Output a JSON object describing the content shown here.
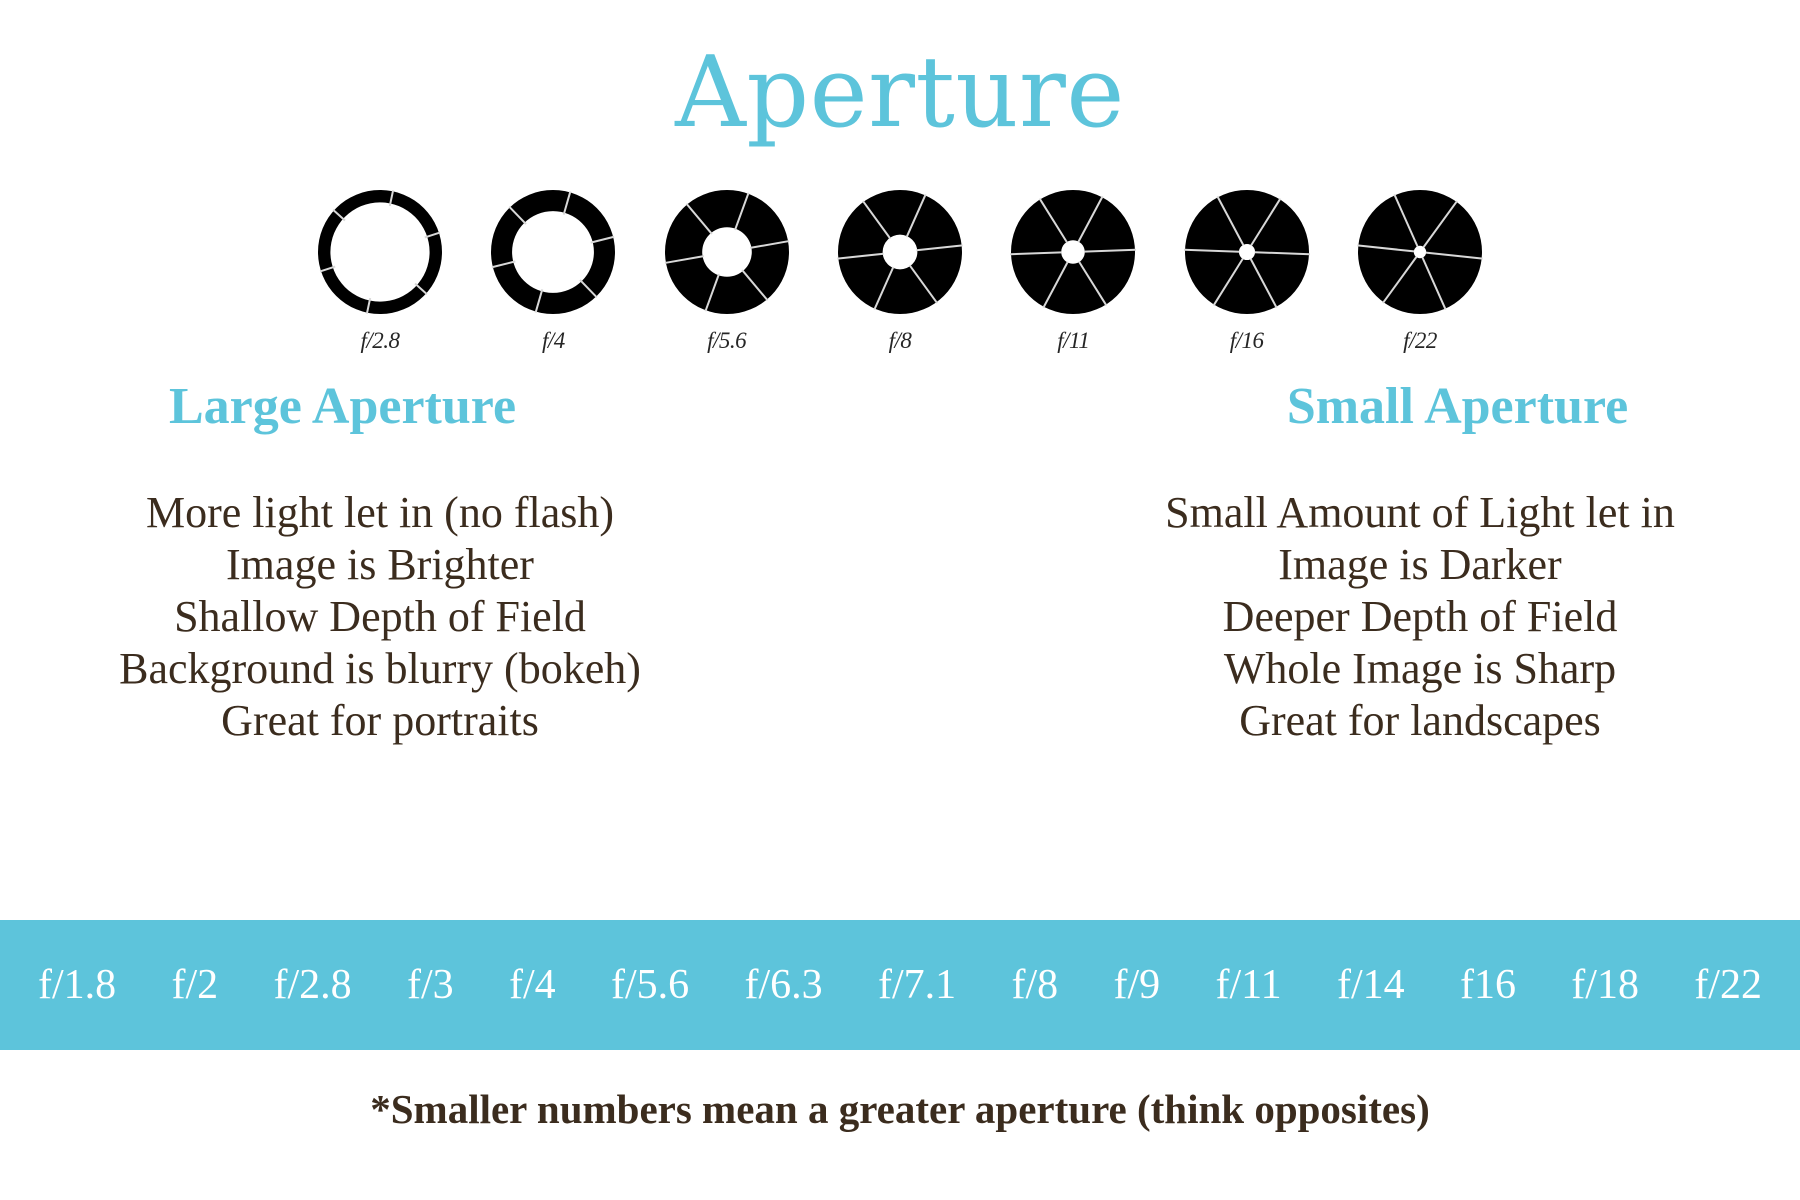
{
  "title": "Aperture",
  "colors": {
    "accent": "#5dc4db",
    "text": "#3b2c1e",
    "bar_background": "#5dc4db",
    "bar_text": "#ffffff",
    "aperture_blade": "#000000"
  },
  "aperture_strip": {
    "name": "aperture-blade-diagram",
    "stops": [
      {
        "label": "f/2.8",
        "opening_ratio": 0.8
      },
      {
        "label": "f/4",
        "opening_ratio": 0.66
      },
      {
        "label": "f/5.6",
        "opening_ratio": 0.4
      },
      {
        "label": "f/8",
        "opening_ratio": 0.28
      },
      {
        "label": "f/11",
        "opening_ratio": 0.19
      },
      {
        "label": "f/16",
        "opening_ratio": 0.13
      },
      {
        "label": "f/22",
        "opening_ratio": 0.1
      }
    ]
  },
  "columns": {
    "left": {
      "heading": "Large Aperture",
      "lines": [
        "More light let in (no flash)",
        "Image is Brighter",
        "Shallow Depth of Field",
        "Background is blurry (bokeh)",
        "Great for portraits"
      ]
    },
    "right": {
      "heading": "Small Aperture",
      "lines": [
        "Small Amount of Light let in",
        "Image is Darker",
        "Deeper Depth of Field",
        "Whole Image is Sharp",
        "Great for landscapes"
      ]
    }
  },
  "fstop_bar": {
    "values": [
      "f/1.8",
      "f/2",
      "f/2.8",
      "f/3",
      "f/4",
      "f/5.6",
      "f/6.3",
      "f/7.1",
      "f/8",
      "f/9",
      "f/11",
      "f/14",
      "f16",
      "f/18",
      "f/22"
    ]
  },
  "footnote": "*Smaller numbers mean a greater aperture (think opposites)"
}
